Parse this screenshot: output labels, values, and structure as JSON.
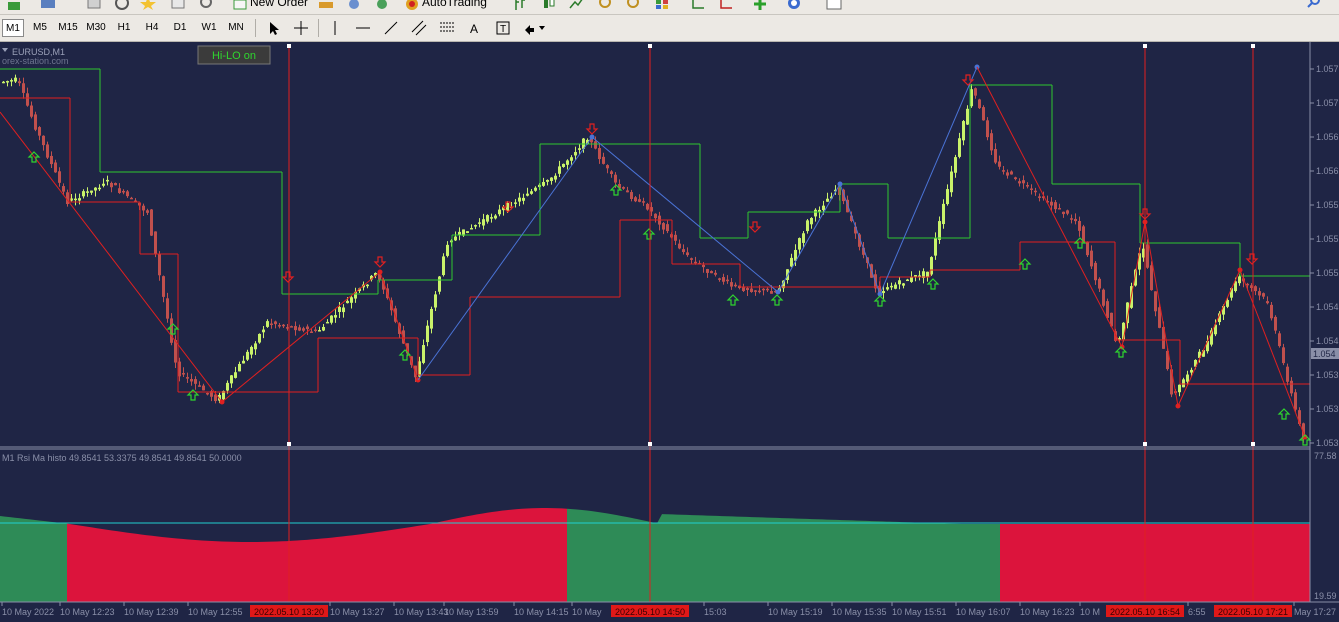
{
  "toolbar": {
    "new_order_label": "New Order",
    "autotrading_label": "AutoTrading",
    "timeframes": [
      "M1",
      "M5",
      "M15",
      "M30",
      "H1",
      "H4",
      "D1",
      "W1",
      "MN"
    ],
    "active_timeframe": "M1",
    "tools": [
      "cursor-icon",
      "crosshair-icon",
      "vertical-line-icon",
      "horizontal-line-icon",
      "trendline-icon",
      "fibonacci-icon",
      "channel-icon",
      "text-icon",
      "text-label-icon",
      "arrows-icon"
    ]
  },
  "chart": {
    "symbol_label": "EURUSD,M1",
    "watermark": "orex-station.com",
    "hilo_button": "Hi-LO on",
    "indicator_label": "M1 Rsi Ma histo 49.8541 53.3375 49.8541 49.8541 50.0000",
    "price_ticks": [
      "1.057",
      "1.057",
      "1.056",
      "1.056",
      "1.055",
      "1.055",
      "1.055",
      "1.054",
      "1.054",
      "1.053",
      "1.053",
      "1.053"
    ],
    "current_price_label": "1.054",
    "indicator_ticks": [
      "77.58",
      "19.59"
    ],
    "time_labels": [
      "10 May 2022",
      "10 May 12:23",
      "10 May 12:39",
      "10 May 12:55",
      "10 May 13:27",
      "10 May 13:43",
      "10 May 13:59",
      "10 May 14:15",
      "10 May",
      "15:03",
      "10 May 15:19",
      "10 May 15:35",
      "10 May 15:51",
      "10 May 16:07",
      "10 May 16:23",
      "10 M",
      "6:55",
      "May 17:27"
    ],
    "vline_labels": [
      "2022.05.10 13:20",
      "2022.05.10 14:50",
      "2022.05.10 16:54",
      "2022.05.10 17:21"
    ],
    "colors": {
      "background": "#1f2545",
      "bull": "#c9f26a",
      "bear": "#c0504d",
      "hilo_high": "#2fc72f",
      "hilo_low": "#e02020",
      "zigzag": "#4a73d6",
      "histo_green": "#2e8b57",
      "histo_red": "#dc143c",
      "signal": "#20d0d0"
    }
  }
}
